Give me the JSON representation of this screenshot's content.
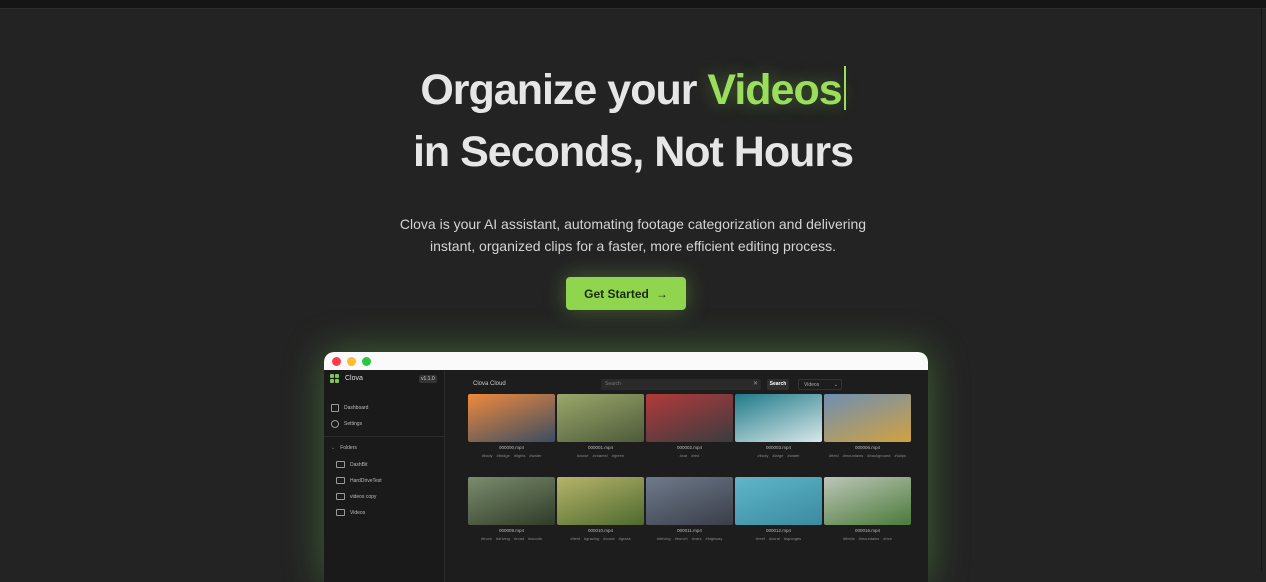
{
  "hero": {
    "line1_prefix": "Organize your ",
    "line1_highlight": "Videos",
    "line2": "in Seconds, Not Hours",
    "subtitle": "Clova is your AI assistant, automating footage categorization and delivering instant, organized clips for a faster, more efficient editing process.",
    "cta_label": "Get Started",
    "cta_icon": "arrow-right-icon",
    "accent_color": "#9ade5b"
  },
  "preview": {
    "app_name": "Clova",
    "version": "v1.1.0",
    "sidebar": {
      "nav": [
        {
          "label": "Dashboard",
          "icon": "dashboard-icon"
        },
        {
          "label": "Settings",
          "icon": "gear-icon"
        }
      ],
      "folders_label": "Folders",
      "folders": [
        "DashBit",
        "HardDriveTest",
        "videos copy",
        "Videos"
      ]
    },
    "main": {
      "title": "Clova Cloud",
      "search_placeholder": "Search",
      "search_button": "Search",
      "filter_value": "Videos"
    },
    "videos_row1": [
      {
        "name": "000000.mp4",
        "tags": [
          "#body",
          "#bridge",
          "#lights",
          "#water"
        ],
        "colors": [
          "#ef8a3c",
          "#3a4d62"
        ]
      },
      {
        "name": "000001.mp4",
        "tags": [
          "#close",
          "#chamel",
          "#green"
        ],
        "colors": [
          "#9aa86a",
          "#4e5a3a"
        ]
      },
      {
        "name": "000002.mp4",
        "tags": [
          "#car",
          "#red"
        ],
        "colors": [
          "#b23a3a",
          "#3a3c40"
        ]
      },
      {
        "name": "000003.mp4",
        "tags": [
          "#body",
          "#large",
          "#water"
        ],
        "colors": [
          "#1f7b8a",
          "#d9e7e8"
        ]
      },
      {
        "name": "000006.mp4",
        "tags": [
          "#field",
          "#mountains",
          "#background",
          "#tulips"
        ],
        "colors": [
          "#6e8fb3",
          "#d1a23f"
        ]
      }
    ],
    "videos_row2": [
      {
        "name": "000009.mp4",
        "tags": [
          "#truck",
          "#driving",
          "#road",
          "#woods"
        ],
        "colors": [
          "#7b8c6d",
          "#2f3c28"
        ]
      },
      {
        "name": "000010.mp4",
        "tags": [
          "#field",
          "#grazing",
          "#cows",
          "#grass"
        ],
        "colors": [
          "#b6b46a",
          "#4e6a2e"
        ]
      },
      {
        "name": "000011.mp4",
        "tags": [
          "#driving",
          "#bunch",
          "#cars",
          "#highway"
        ],
        "colors": [
          "#6e7a8c",
          "#3a3e48"
        ]
      },
      {
        "name": "000012.mp4",
        "tags": [
          "#reef",
          "#coral",
          "#sponges"
        ],
        "colors": [
          "#5fb7c8",
          "#3b8aa0"
        ]
      },
      {
        "name": "000016.mp4",
        "tags": [
          "#fields",
          "#mountains",
          "#rice"
        ],
        "colors": [
          "#bcc6b7",
          "#4b7a3a"
        ]
      }
    ]
  }
}
